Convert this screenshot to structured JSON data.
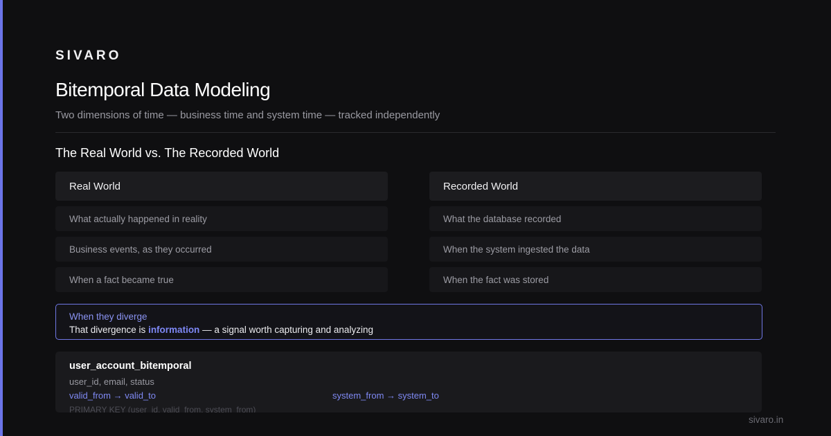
{
  "brand": "SIVARO",
  "title": "Bitemporal Data Modeling",
  "subtitle": "Two dimensions of time — business time and system time — tracked independently",
  "section_title": "The Real World vs. The Recorded World",
  "real_world": {
    "heading": "Real World",
    "items": [
      "What actually happened in reality",
      "Business events, as they occurred",
      "When a fact became true"
    ]
  },
  "recorded_world": {
    "heading": "Recorded World",
    "items": [
      "What the database recorded",
      "When the system ingested the data",
      "When the fact was stored"
    ]
  },
  "diverge": {
    "label": "When they diverge",
    "text_before": "That divergence is ",
    "highlight": "information",
    "text_after": " — a signal worth capturing and analyzing"
  },
  "schema": {
    "table_name": "user_account_bitemporal",
    "columns": "user_id, email, status",
    "valid_range": "valid_from → valid_to",
    "system_range": "system_from → system_to",
    "primary_key": "PRIMARY KEY (user_id, valid_from, system_from)"
  },
  "footer": "sivaro.in",
  "colors": {
    "accent": "#6b74e8",
    "background": "#0f0f11"
  }
}
